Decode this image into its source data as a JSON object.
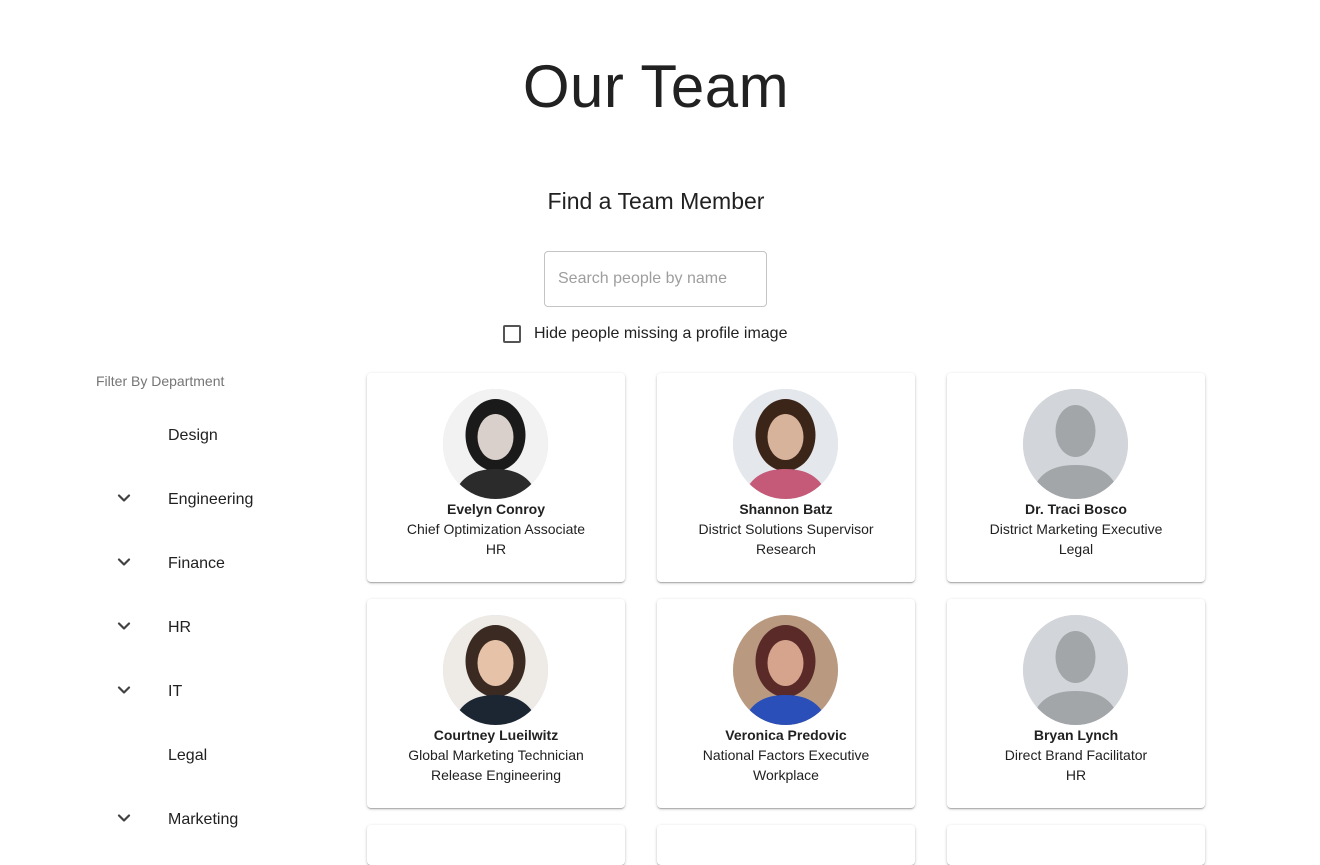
{
  "page": {
    "title": "Our Team",
    "find_heading": "Find a Team Member"
  },
  "search": {
    "placeholder": "Search people by name",
    "value": ""
  },
  "hide_missing": {
    "label": "Hide people missing a profile image",
    "checked": false
  },
  "filter": {
    "title": "Filter By Department",
    "departments": [
      {
        "label": "Design",
        "expandable": false
      },
      {
        "label": "Engineering",
        "expandable": true
      },
      {
        "label": "Finance",
        "expandable": true
      },
      {
        "label": "HR",
        "expandable": true
      },
      {
        "label": "IT",
        "expandable": true
      },
      {
        "label": "Legal",
        "expandable": false
      },
      {
        "label": "Marketing",
        "expandable": true
      }
    ],
    "chevron_icon": "chevron-down-icon"
  },
  "members": [
    {
      "name": "Evelyn Conroy",
      "title": "Chief Optimization Associate",
      "department": "HR",
      "avatar": "photo"
    },
    {
      "name": "Shannon Batz",
      "title": "District Solutions Supervisor",
      "department": "Research",
      "avatar": "photo"
    },
    {
      "name": "Dr. Traci Bosco",
      "title": "District Marketing Executive",
      "department": "Legal",
      "avatar": "placeholder"
    },
    {
      "name": "Courtney Lueilwitz",
      "title": "Global Marketing Technician",
      "department": "Release Engineering",
      "avatar": "photo"
    },
    {
      "name": "Veronica Predovic",
      "title": "National Factors Executive",
      "department": "Workplace",
      "avatar": "photo"
    },
    {
      "name": "Bryan Lynch",
      "title": "Direct Brand Facilitator",
      "department": "HR",
      "avatar": "placeholder"
    }
  ],
  "colors": {
    "text": "#212121",
    "muted": "#757575",
    "placeholder_avatar_bg": "#d2d5d9",
    "placeholder_avatar_fg": "#a3a6a9"
  }
}
